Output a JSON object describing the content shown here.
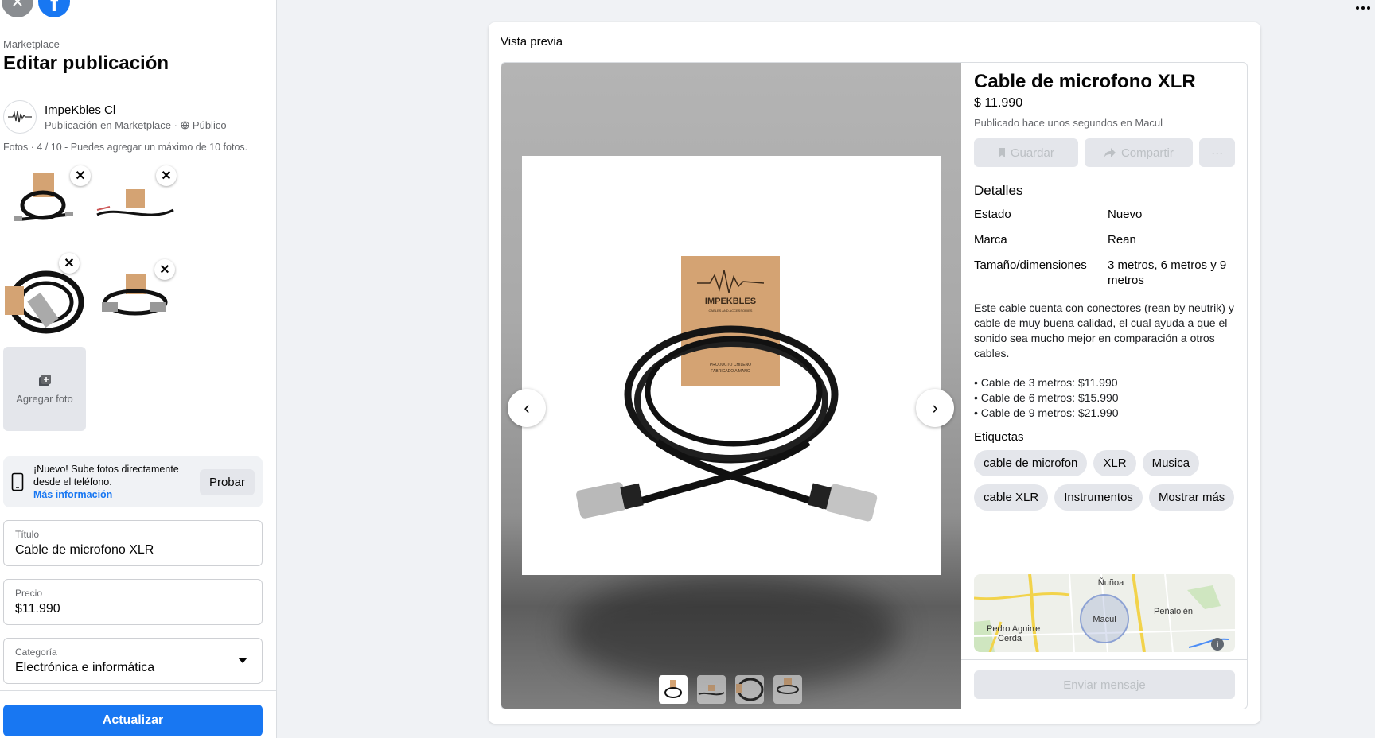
{
  "sidebar": {
    "breadcrumb": "Marketplace",
    "title": "Editar publicación",
    "seller_name": "ImpeKbles Cl",
    "seller_sub": "Publicación en Marketplace · ",
    "audience": "Público",
    "photos_label": "Fotos",
    "photos_count": "4 / 10",
    "photos_hint": " - Puedes agregar un máximo de 10 fotos.",
    "add_photo": "Agregar foto",
    "promo_new": "¡Nuevo!",
    "promo_text": " Sube fotos directamente desde el teléfono.",
    "promo_link": "Más información",
    "promo_button": "Probar",
    "fields": {
      "title_label": "Título",
      "title_value": "Cable de microfono XLR",
      "price_label": "Precio",
      "price_value": "$11.990",
      "category_label": "Categoría",
      "category_value": "Electrónica e informática"
    },
    "update_button": "Actualizar"
  },
  "preview": {
    "header": "Vista previa",
    "title": "Cable de microfono XLR",
    "price": "$ 11.990",
    "posted": "Publicado hace unos segundos en Macul",
    "save": "Guardar",
    "share": "Compartir",
    "more": "···",
    "details_heading": "Detalles",
    "details": [
      {
        "label": "Estado",
        "value": "Nuevo"
      },
      {
        "label": "Marca",
        "value": "Rean"
      },
      {
        "label": "Tamaño/dimensiones",
        "value": "3 metros, 6 metros y 9 metros"
      }
    ],
    "description": "Este cable cuenta con conectores (rean by neutrik) y cable de muy buena calidad, el cual ayuda a que el sonido sea mucho mejor en comparación a otros cables.",
    "bullets": [
      "• Cable de 3 metros: $11.990",
      "• Cable de 6 metros: $15.990",
      "• Cable de 9 metros: $21.990"
    ],
    "tags_heading": "Etiquetas",
    "tags": [
      "cable de microfon",
      "XLR",
      "Musica",
      "cable XLR",
      "Instrumentos",
      "Mostrar más"
    ],
    "map_labels": {
      "n": "Ñuñoa",
      "e": "Peñalolén",
      "c": "Macul",
      "w1": "Pedro Aguirre",
      "w2": "Cerda"
    },
    "message_button": "Enviar mensaje",
    "product_brand": "IMPEKBLES",
    "product_tag1": "CABLES AND ACCESSORIES",
    "product_tag2": "PRODUCTO CHILENO",
    "product_tag3": "FABRICADO A MANO"
  },
  "icons": [
    "close-icon",
    "facebook-icon",
    "globe-icon",
    "photo-add-icon",
    "phone-icon",
    "chevron-down-icon",
    "chevron-left-icon",
    "chevron-right-icon",
    "bookmark-icon",
    "share-icon",
    "info-icon",
    "apps-grid-icon"
  ],
  "colors": {
    "brand": "#1877f2",
    "disabled_text": "#bcc0c4",
    "button_bg": "#e4e6eb"
  }
}
